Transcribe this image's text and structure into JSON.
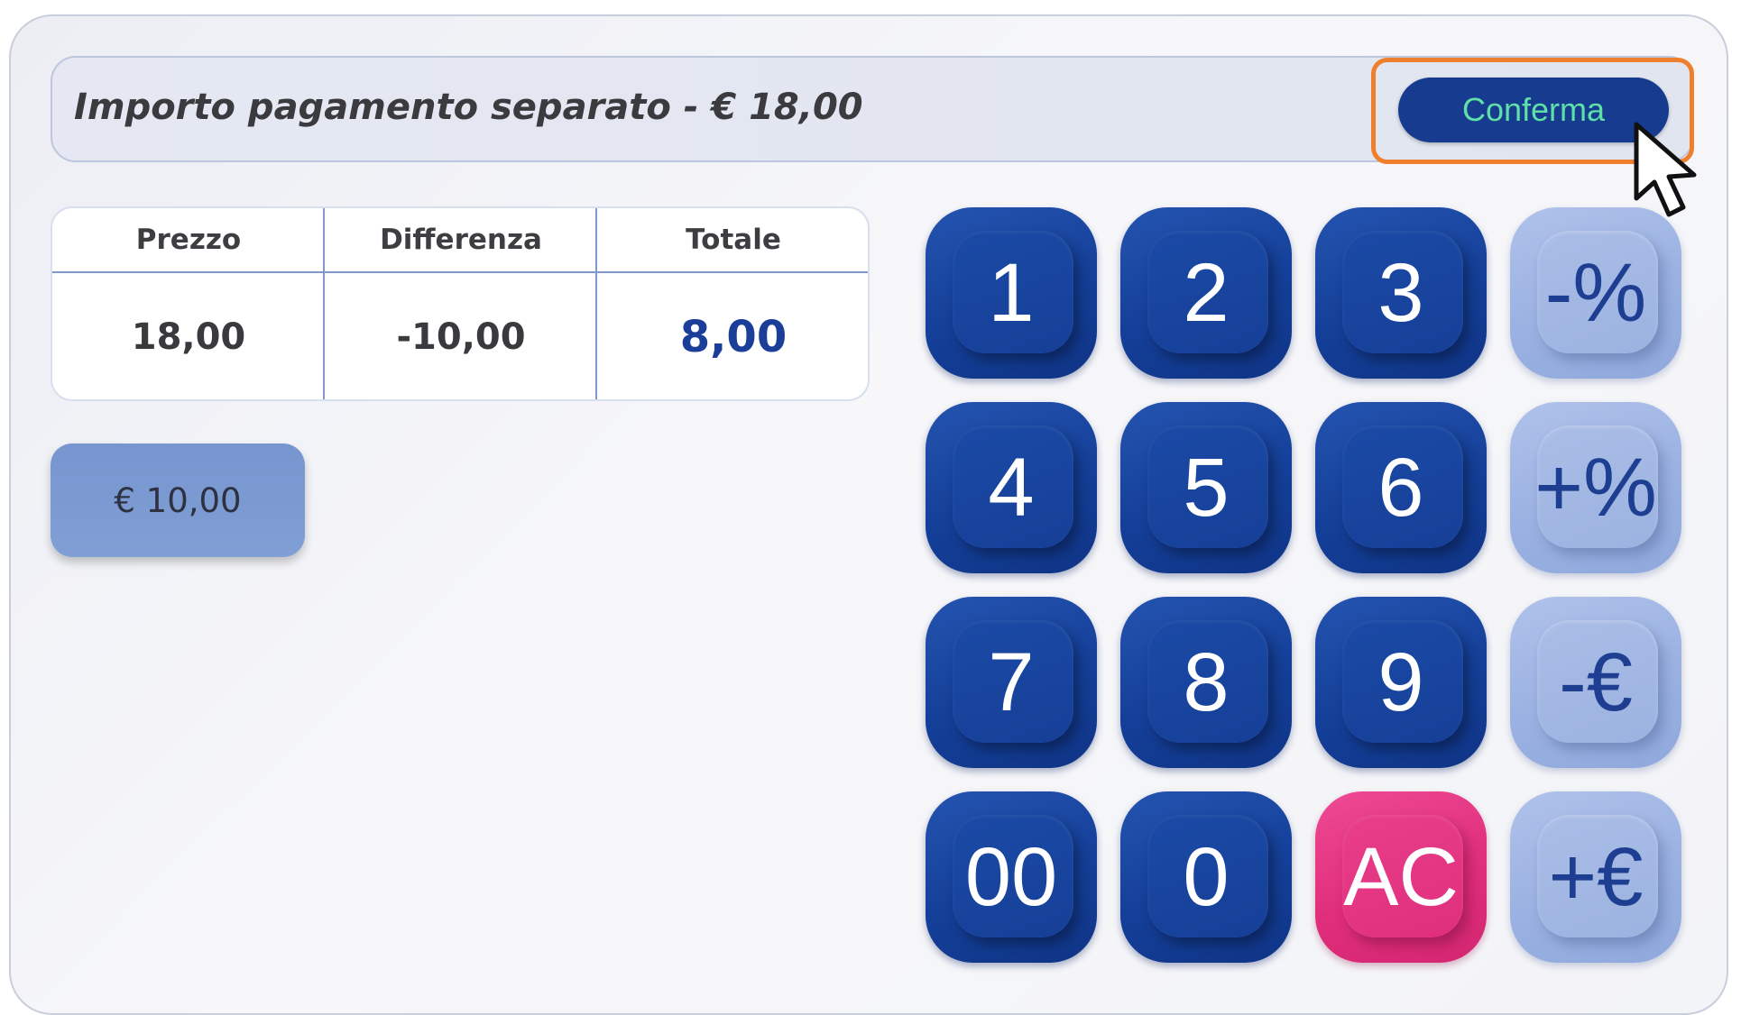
{
  "header": {
    "title": "Importo pagamento separato - € 18,00",
    "confirm_label": "Conferma"
  },
  "summary": {
    "columns": [
      "Prezzo",
      "Differenza",
      "Totale"
    ],
    "values": [
      "18,00",
      "-10,00",
      "8,00"
    ]
  },
  "amount_chip": {
    "label": "€ 10,00"
  },
  "keypad": {
    "k1": "1",
    "k2": "2",
    "k3": "3",
    "pct_minus": "-%",
    "k4": "4",
    "k5": "5",
    "k6": "6",
    "pct_plus": "+%",
    "k7": "7",
    "k8": "8",
    "k9": "9",
    "eur_minus": "-€",
    "k00": "00",
    "k0": "0",
    "clear": "AC",
    "eur_plus": "+€"
  },
  "colors": {
    "key_primary": "#173b8e",
    "key_operator": "#9ab1e1",
    "key_clear": "#e02e7c",
    "confirm_text": "#5ee0a8",
    "highlight": "#ee7f2d",
    "total_value": "#1b3f98"
  },
  "icons": {
    "cursor": "mouse-pointer-icon"
  }
}
